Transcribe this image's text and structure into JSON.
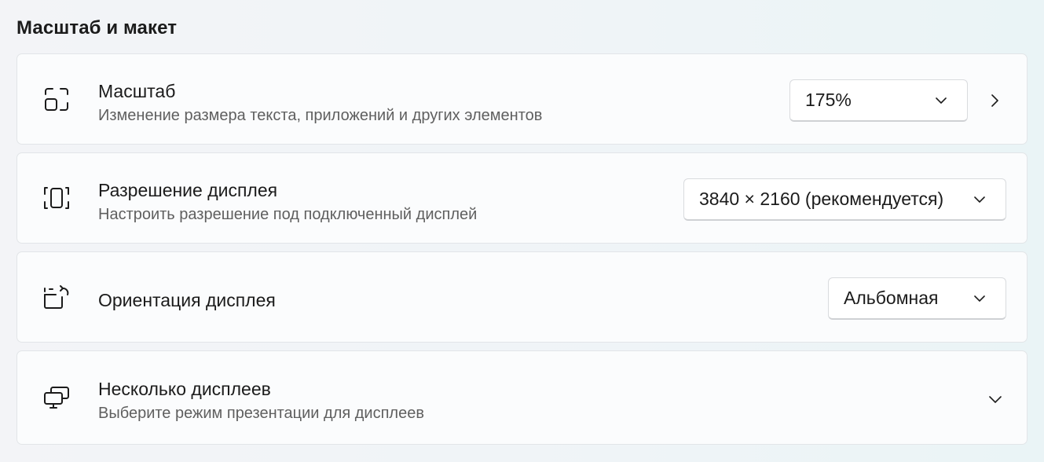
{
  "section": {
    "title": "Масштаб и макет"
  },
  "cards": [
    {
      "title": "Масштаб",
      "subtitle": "Изменение размера текста, приложений и других элементов",
      "icon": "scale-icon",
      "dropdown_value": "175%",
      "trailing_icon": "chevron-right-icon"
    },
    {
      "title": "Разрешение дисплея",
      "subtitle": "Настроить разрешение под подключенный дисплей",
      "icon": "resolution-icon",
      "dropdown_value": "3840 × 2160 (рекомендуется)"
    },
    {
      "title": "Ориентация дисплея",
      "icon": "orientation-icon",
      "dropdown_value": "Альбомная"
    },
    {
      "title": "Несколько дисплеев",
      "subtitle": "Выберите режим презентации для дисплеев",
      "icon": "multiple-displays-icon",
      "trailing_icon": "chevron-down-icon"
    }
  ]
}
